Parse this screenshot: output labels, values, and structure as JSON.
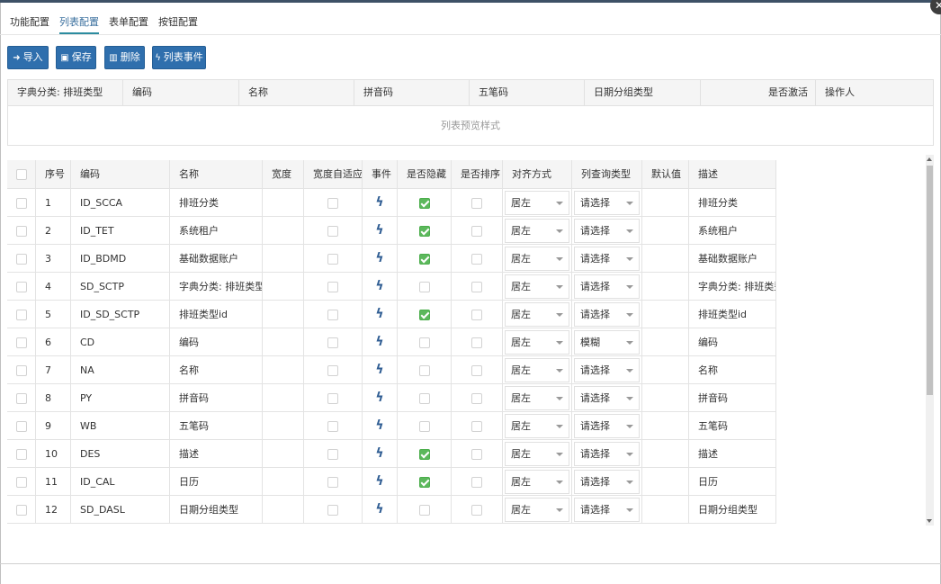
{
  "tabs": [
    "功能配置",
    "列表配置",
    "表单配置",
    "按钮配置"
  ],
  "active_tab": 1,
  "toolbar": {
    "import": "导入",
    "save": "保存",
    "delete": "删除",
    "events": "列表事件"
  },
  "preview": {
    "headers": [
      "字典分类: 排班类型",
      "编码",
      "名称",
      "拼音码",
      "五笔码",
      "日期分组类型",
      "是否激活",
      "操作人"
    ],
    "empty_text": "列表预览样式"
  },
  "grid": {
    "headers": [
      "序号",
      "编码",
      "名称",
      "宽度",
      "宽度自适应",
      "事件",
      "是否隐藏",
      "是否排序",
      "对齐方式",
      "列查询类型",
      "默认值",
      "描述"
    ],
    "rows": [
      {
        "no": "1",
        "code": "ID_SCCA",
        "name": "排班分类",
        "hidden": true,
        "align": "居左",
        "query": "请选择",
        "desc": "排班分类"
      },
      {
        "no": "2",
        "code": "ID_TET",
        "name": "系统租户",
        "hidden": true,
        "align": "居左",
        "query": "请选择",
        "desc": "系统租户"
      },
      {
        "no": "3",
        "code": "ID_BDMD",
        "name": "基础数据账户",
        "hidden": true,
        "align": "居左",
        "query": "请选择",
        "desc": "基础数据账户"
      },
      {
        "no": "4",
        "code": "SD_SCTP",
        "name": "字典分类: 排班类型",
        "hidden": false,
        "align": "居左",
        "query": "请选择",
        "desc": "字典分类: 排班类型"
      },
      {
        "no": "5",
        "code": "ID_SD_SCTP",
        "name": "排班类型id",
        "hidden": true,
        "align": "居左",
        "query": "请选择",
        "desc": "排班类型id"
      },
      {
        "no": "6",
        "code": "CD",
        "name": "编码",
        "hidden": false,
        "align": "居左",
        "query": "模糊",
        "desc": "编码"
      },
      {
        "no": "7",
        "code": "NA",
        "name": "名称",
        "hidden": false,
        "align": "居左",
        "query": "请选择",
        "desc": "名称"
      },
      {
        "no": "8",
        "code": "PY",
        "name": "拼音码",
        "hidden": false,
        "align": "居左",
        "query": "请选择",
        "desc": "拼音码"
      },
      {
        "no": "9",
        "code": "WB",
        "name": "五笔码",
        "hidden": false,
        "align": "居左",
        "query": "请选择",
        "desc": "五笔码"
      },
      {
        "no": "10",
        "code": "DES",
        "name": "描述",
        "hidden": true,
        "align": "居左",
        "query": "请选择",
        "desc": "描述"
      },
      {
        "no": "11",
        "code": "ID_CAL",
        "name": "日历",
        "hidden": true,
        "align": "居左",
        "query": "请选择",
        "desc": "日历"
      },
      {
        "no": "12",
        "code": "SD_DASL",
        "name": "日期分组类型",
        "hidden": false,
        "align": "居左",
        "query": "请选择",
        "desc": "日期分组类型"
      }
    ]
  },
  "colors": {
    "button": "#2f6fad",
    "active_tab": "#2c8ca0",
    "checked": "#5cb85c",
    "bolt": "#2f5d93"
  },
  "icons": {
    "close": "close-icon",
    "import": "sign-in-icon",
    "save": "floppy-icon",
    "delete": "trash-icon",
    "events": "bolt-icon"
  }
}
